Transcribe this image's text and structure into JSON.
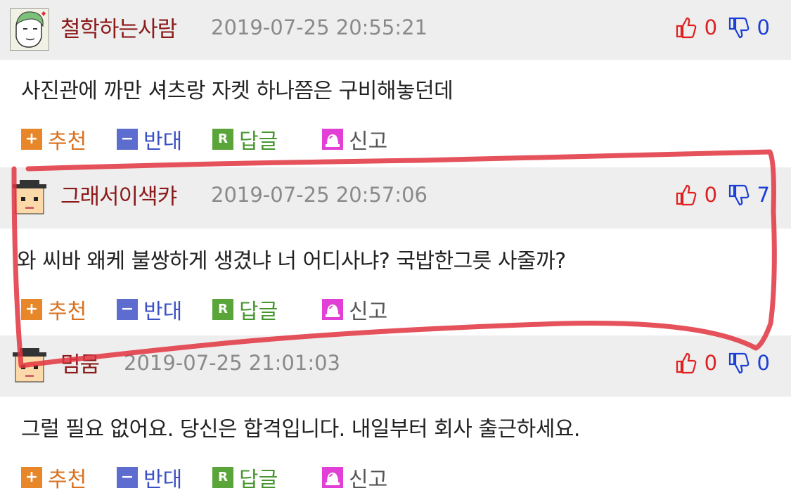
{
  "comments": [
    {
      "nickname": "철학하는사람",
      "date": "2019-07-25 20:55:21",
      "up": "0",
      "down": "0",
      "text": "사진관에 까만 셔츠랑 자켓 하나쯤은 구비해놓던데"
    },
    {
      "nickname": "그래서이색캬",
      "date": "2019-07-25 20:57:06",
      "up": "0",
      "down": "7",
      "text": "와 씨바 왜케 불쌍하게 생겼냐 너 어디사냐? 국밥한그릇 사줄까?"
    },
    {
      "nickname": "멈뭄",
      "date": "2019-07-25 21:01:03",
      "up": "0",
      "down": "0",
      "text": "그럴 필요 없어요. 당신은 합격입니다. 내일부터 회사 출근하세요."
    }
  ],
  "actions": {
    "recommend": "추천",
    "oppose": "반대",
    "reply": "답글",
    "report": "신고"
  },
  "icons": [
    "plus-icon",
    "minus-icon",
    "reply-r-icon",
    "siren-icon",
    "thumbs-up-icon",
    "thumbs-down-icon"
  ],
  "colors": {
    "nickname": "#8b1a1a",
    "up_count": "#e01f1f",
    "down_count": "#1a3fd6",
    "annotation": "#e0343e"
  }
}
